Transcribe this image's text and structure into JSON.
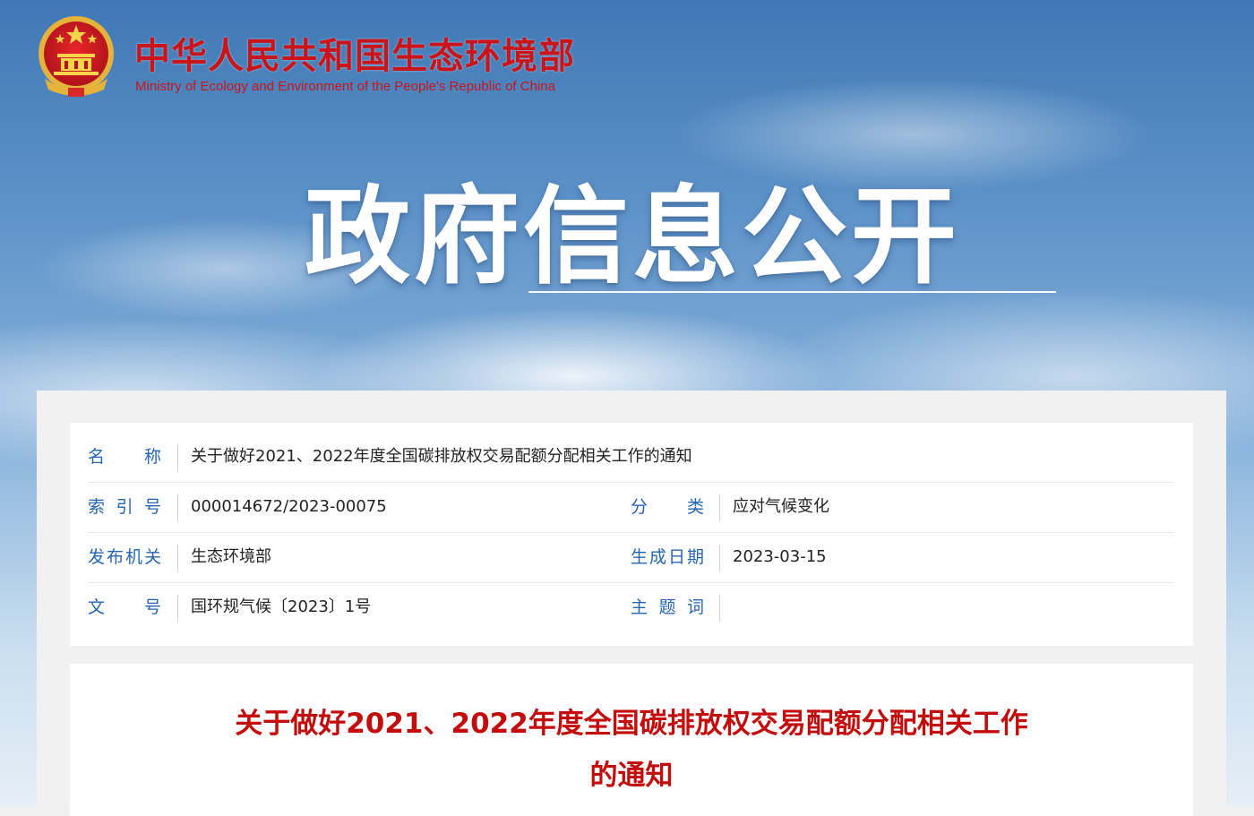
{
  "site": {
    "title_cn": "中华人民共和国生态环境部",
    "title_en": "Ministry of Ecology and Environment of the People's Republic of China"
  },
  "hero": {
    "title": "政府信息公开"
  },
  "info": {
    "name_label": "名称",
    "name_value": "关于做好2021、2022年度全国碳排放权交易配额分配相关工作的通知",
    "index_label": "索引号",
    "index_value": "000014672/2023-00075",
    "category_label": "分类",
    "category_value": "应对气候变化",
    "publisher_label": "发布机关",
    "publisher_value": "生态环境部",
    "date_label": "生成日期",
    "date_value": "2023-03-15",
    "docno_label": "文号",
    "docno_value": "国环规气候〔2023〕1号",
    "keywords_label": "主题词",
    "keywords_value": ""
  },
  "document": {
    "title_line1": "关于做好2021、2022年度全国碳排放权交易配额分配相关工作",
    "title_line2": "的通知"
  },
  "colors": {
    "brand_red": "#c9141b",
    "label_blue": "#2566b3",
    "doc_title_red": "#c30d0d"
  }
}
